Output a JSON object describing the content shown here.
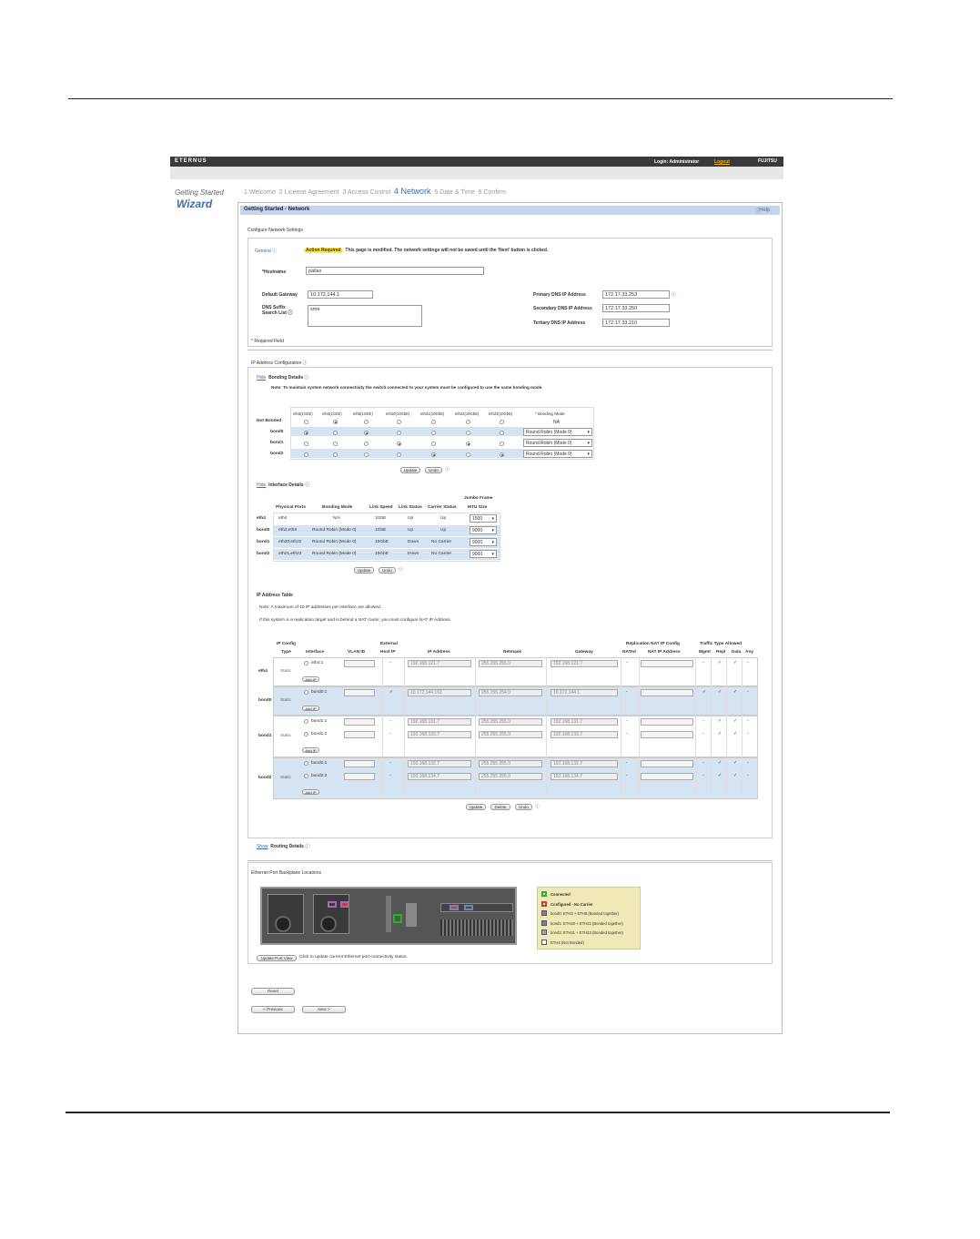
{
  "app": {
    "brand": "ETERNUS",
    "login": "Login: Administrator",
    "logout": "Logout",
    "vendor": "FUJITSU"
  },
  "wizard": {
    "title_small": "Getting Started",
    "title_big": "Wizard"
  },
  "steps": [
    {
      "num": "1",
      "label": "Welcome"
    },
    {
      "num": "2",
      "label": "License Agreement"
    },
    {
      "num": "3",
      "label": "Access Control"
    },
    {
      "num": "4",
      "label": "Network"
    },
    {
      "num": "5",
      "label": "Date & Time"
    },
    {
      "num": "6",
      "label": "Confirm"
    }
  ],
  "panel": {
    "title": "Getting Started - Network",
    "help": "Help",
    "section": "Configure Network Settings"
  },
  "general": {
    "label": "General",
    "badge": "Action Required",
    "message": "This page is modified. The network settings will not be saved until the 'Next' button is clicked.",
    "hostname_label": "*Hostname",
    "hostname": "pallas",
    "gateway_label": "Default Gateway",
    "gateway": "10.172.144.1",
    "dns_suffix_label1": "DNS Suffix",
    "dns_suffix_label2": "Search List",
    "dns_suffix": "sme",
    "dns1_label": "Primary DNS IP Address",
    "dns1": "172.17.33.253",
    "dns2_label": "Secondary DNS IP Address",
    "dns2": "172.17.33.250",
    "dns3_label": "Tertiary DNS IP Address",
    "dns3": "172.17.33.210",
    "required": "* Required Field"
  },
  "ipconfig": {
    "label": "IP Address Configuration"
  },
  "bonding": {
    "hide": "Hide",
    "title": "Bonding Details",
    "note": "Note: To maintain system network connectivity the switch connected to your system must be configured to use the same bonding mode.",
    "cols": [
      "eth3(1GbE)",
      "eth4(1GbE)",
      "eth8(1GbE)",
      "eth20(10GbE)",
      "eth21(10GbE)",
      "eth22(10GbE)",
      "eth23(10GbE)"
    ],
    "mode_header": "* Bonding Mode",
    "rows": [
      {
        "name": "Not Bonded",
        "mode": "NA"
      },
      {
        "name": "bond0",
        "mode": "Round Robin (Mode 0)"
      },
      {
        "name": "bond1",
        "mode": "Round Robin (Mode 0)"
      },
      {
        "name": "bond2",
        "mode": "Round Robin (Mode 0)"
      }
    ],
    "update": "Update",
    "undo": "Undo"
  },
  "iface": {
    "hide": "Hide",
    "title": "Interface Details",
    "headers": [
      "Physical Ports",
      "Bonding Mode",
      "Link Speed",
      "Link Status",
      "Carrier Status",
      "Jumbo Frame",
      "MTU Size"
    ],
    "rows": [
      {
        "name": "eth4",
        "ports": "eth4",
        "mode": "N/A",
        "speed": "1GbE",
        "link": "Up",
        "carrier": "Up",
        "mtu": "1500"
      },
      {
        "name": "bond0",
        "ports": "eth3,eth8",
        "mode": "Round Robin (Mode 0)",
        "speed": "1GbE",
        "link": "Up",
        "carrier": "Up",
        "mtu": "9000"
      },
      {
        "name": "bond1",
        "ports": "eth20,eth22",
        "mode": "Round Robin (Mode 0)",
        "speed": "10GbE",
        "link": "Down",
        "carrier": "No Carrier",
        "mtu": "9000"
      },
      {
        "name": "bond2",
        "ports": "eth21,eth23",
        "mode": "Round Robin (Mode 0)",
        "speed": "10GbE",
        "link": "Down",
        "carrier": "No Carrier",
        "mtu": "9000"
      }
    ],
    "update": "Update",
    "undo": "Undo"
  },
  "iptable": {
    "title": "IP Address Table",
    "note1": "Note: A maximum of 10 IP addresses per interface are allowed.",
    "note2": "If this system is a replication target and is behind a NAT router, you must configure NAT IP Address.",
    "h_ipconfig": "IP Config",
    "h_type": "Type",
    "h_interface": "Interface",
    "h_vlan": "VLAN ID",
    "h_external": "External",
    "h_hostip": "Host IP",
    "h_ip": "IP Address",
    "h_netmask": "Netmask",
    "h_gateway": "Gateway",
    "h_repl": "Replication NAT IP Config",
    "h_nated": "NATed",
    "h_natip": "NAT IP Address",
    "h_traffic": "Traffic Type Allowed",
    "h_mgmt": "Mgmt",
    "h_repl2": "Repl",
    "h_data": "Data",
    "h_any": "Any",
    "add_ip": "Add IP",
    "groups": [
      {
        "name": "eth4",
        "type": "Static",
        "rows": [
          {
            "iface": "eth4:1",
            "host": "-",
            "ip": "192.168.121.7",
            "mask": "255.255.255.0",
            "gw": "192.168.121.7",
            "nat": "-",
            "mgmt": "-",
            "repl": "✓",
            "data": "✓",
            "any": "-"
          }
        ]
      },
      {
        "name": "bond0",
        "type": "Static",
        "rows": [
          {
            "iface": "bond0:1",
            "host": "✓",
            "ip": "10.172.144.161",
            "mask": "255.255.254.0",
            "gw": "10.172.144.1",
            "nat": "-",
            "mgmt": "✓",
            "repl": "✓",
            "data": "✓",
            "any": "-"
          }
        ]
      },
      {
        "name": "bond1",
        "type": "Static",
        "rows": [
          {
            "iface": "bond1:1",
            "host": "-",
            "ip": "192.168.131.7",
            "mask": "255.255.255.0",
            "gw": "192.168.131.7",
            "nat": "-",
            "mgmt": "-",
            "repl": "✓",
            "data": "✓",
            "any": "-"
          },
          {
            "iface": "bond1:2",
            "host": "-",
            "ip": "192.168.133.7",
            "mask": "255.255.255.0",
            "gw": "192.168.133.7",
            "nat": "-",
            "mgmt": "-",
            "repl": "✓",
            "data": "✓",
            "any": "-"
          }
        ]
      },
      {
        "name": "bond2",
        "type": "Static",
        "rows": [
          {
            "iface": "bond2:1",
            "host": "-",
            "ip": "192.168.132.7",
            "mask": "255.255.255.0",
            "gw": "192.168.132.7",
            "nat": "-",
            "mgmt": "-",
            "repl": "✓",
            "data": "✓",
            "any": "-"
          },
          {
            "iface": "bond2:2",
            "host": "-",
            "ip": "192.168.134.7",
            "mask": "255.255.255.0",
            "gw": "192.168.134.7",
            "nat": "-",
            "mgmt": "-",
            "repl": "✓",
            "data": "✓",
            "any": "-"
          }
        ]
      }
    ],
    "update": "Update",
    "delete": "Delete",
    "undo": "Undo"
  },
  "routing": {
    "show": "Show",
    "title": "Routing Details"
  },
  "backplane": {
    "title": "Ethernet Port Backplane Locations",
    "update_btn": "Update Port View",
    "update_text": "Click to update current Ethernet port connectivity status.",
    "legend": [
      {
        "label": "Connected",
        "color": "#27b327"
      },
      {
        "label": "Configured - No Carrier",
        "color": "#d23a3a"
      },
      {
        "label": "bond0: ETH3 + ETH8 (Bonded together)",
        "color": "#9b6fb5"
      },
      {
        "label": "bond1: ETH20 + ETH22 (Bonded together)",
        "color": "#6f86b5"
      },
      {
        "label": "bond2: ETH21 + ETH23 (Bonded together)",
        "color": "#aaa3c9"
      },
      {
        "label": "ETH4 (Not Bonded)",
        "color": "#ffffff"
      }
    ]
  },
  "buttons": {
    "reset": "Reset",
    "previous": "< Previous",
    "next": "Next >"
  }
}
